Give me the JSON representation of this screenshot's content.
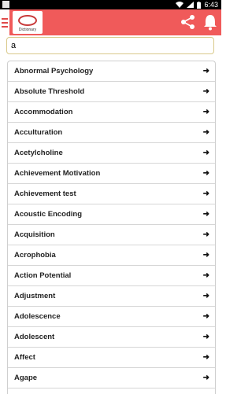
{
  "status_bar": {
    "time": "6:43"
  },
  "app_bar": {
    "logo_caption": "Dictionary",
    "share_icon": "share-icon",
    "bell_icon": "bell-icon",
    "menu_icon": "menu-icon",
    "color": "#f05a5a"
  },
  "search": {
    "value": "a"
  },
  "terms": [
    "Abnormal Psychology",
    "Absolute Threshold",
    "Accommodation",
    "Acculturation",
    "Acetylcholine",
    "Achievement Motivation",
    "Achievement test",
    "Acoustic Encoding",
    "Acquisition",
    "Acrophobia",
    "Action Potential",
    "Adjustment",
    "Adolescence",
    "Adolescent",
    "Affect",
    "Agape"
  ],
  "row_arrow": "➜"
}
